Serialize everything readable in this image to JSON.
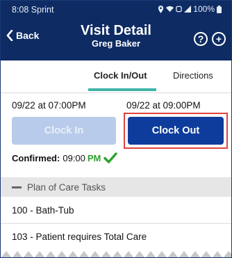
{
  "status_bar": {
    "time_carrier": "8:08 Sprint",
    "battery": "100%"
  },
  "header": {
    "back_label": "Back",
    "title": "Visit Detail",
    "subtitle": "Greg Baker",
    "help_icon": "?",
    "add_icon": "+"
  },
  "tabs": [
    {
      "label": "Clock In/Out",
      "active": true
    },
    {
      "label": "Directions",
      "active": false
    }
  ],
  "schedule": {
    "start": "09/22 at 07:00PM",
    "end": "09/22 at 09:00PM"
  },
  "buttons": {
    "clock_in": "Clock In",
    "clock_out": "Clock Out"
  },
  "confirmed": {
    "label": "Confirmed:",
    "time": "09:00",
    "period": "PM"
  },
  "plan_of_care": {
    "title": "Plan of Care Tasks",
    "tasks": [
      "100 - Bath-Tub",
      "103 - Patient requires Total Care"
    ]
  },
  "colors": {
    "header_bg": "#0e2c63",
    "accent_teal": "#3fb5a6",
    "clock_out_bg": "#0e3c9c",
    "clock_in_disabled_bg": "#b9cbea",
    "highlight_red": "#e0433d",
    "confirm_green": "#2ca12c"
  }
}
